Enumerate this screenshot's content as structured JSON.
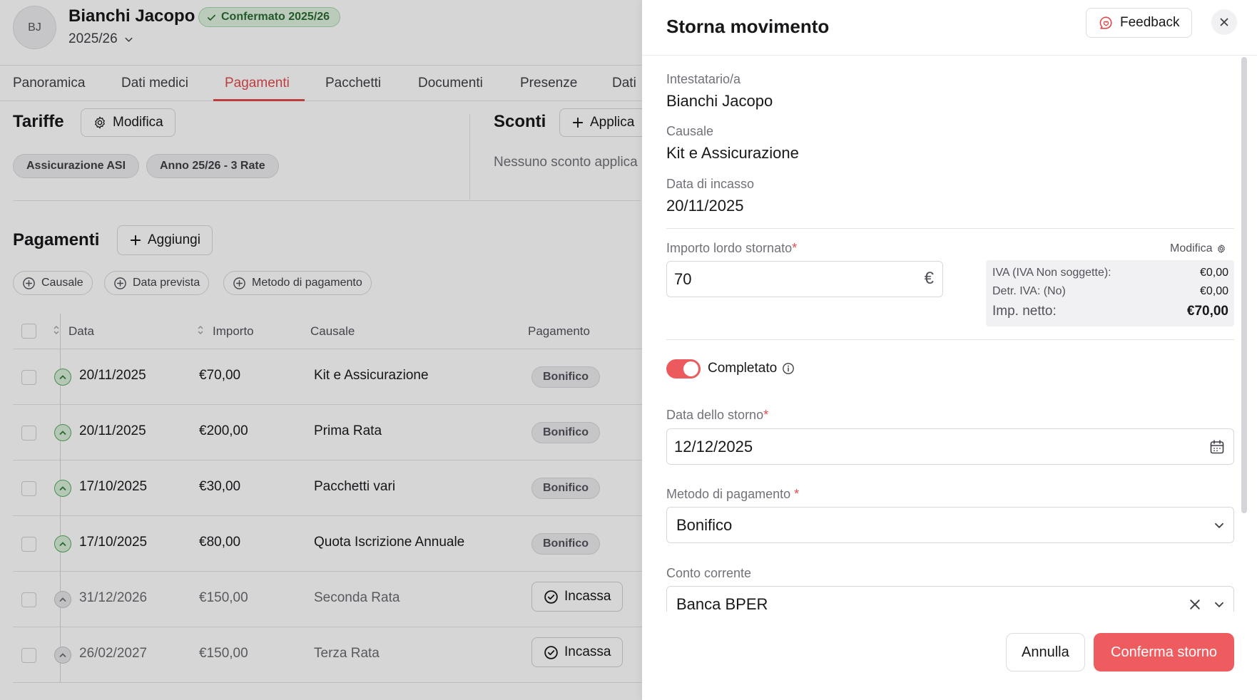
{
  "header": {
    "avatar_initials": "BJ",
    "name": "Bianchi Jacopo",
    "status_badge": "Confermato 2025/26",
    "season": "2025/26"
  },
  "tabs": [
    {
      "label": "Panoramica",
      "active": false
    },
    {
      "label": "Dati medici",
      "active": false
    },
    {
      "label": "Pagamenti",
      "active": true
    },
    {
      "label": "Pacchetti",
      "active": false
    },
    {
      "label": "Documenti",
      "active": false
    },
    {
      "label": "Presenze",
      "active": false
    },
    {
      "label": "Dati",
      "active": false
    }
  ],
  "tariffe": {
    "title": "Tariffe",
    "edit_label": "Modifica",
    "chips": [
      "Assicurazione ASI",
      "Anno 25/26 - 3 Rate"
    ]
  },
  "sconti": {
    "title": "Sconti",
    "apply_label": "Applica",
    "empty_text": "Nessuno sconto applica"
  },
  "pagamenti": {
    "title": "Pagamenti",
    "add_label": "Aggiungi",
    "filters": [
      "Causale",
      "Data prevista",
      "Metodo di pagamento"
    ],
    "columns": {
      "date": "Data",
      "amount": "Importo",
      "causale": "Causale",
      "payment": "Pagamento"
    },
    "rows": [
      {
        "date": "20/11/2025",
        "amount": "€70,00",
        "causale": "Kit e Assicurazione",
        "payment": "Bonifico",
        "status": "paid"
      },
      {
        "date": "20/11/2025",
        "amount": "€200,00",
        "causale": "Prima Rata",
        "payment": "Bonifico",
        "status": "paid"
      },
      {
        "date": "17/10/2025",
        "amount": "€30,00",
        "causale": "Pacchetti vari",
        "payment": "Bonifico",
        "status": "paid"
      },
      {
        "date": "17/10/2025",
        "amount": "€80,00",
        "causale": "Quota Iscrizione Annuale",
        "payment": "Bonifico",
        "status": "paid"
      },
      {
        "date": "31/12/2026",
        "amount": "€150,00",
        "causale": "Seconda Rata",
        "payment": "Incassa",
        "status": "pending"
      },
      {
        "date": "26/02/2027",
        "amount": "€150,00",
        "causale": "Terza Rata",
        "payment": "Incassa",
        "status": "pending"
      }
    ]
  },
  "panel": {
    "title": "Storna movimento",
    "feedback_label": "Feedback",
    "intestatario_label": "Intestatario/a",
    "intestatario_value": "Bianchi Jacopo",
    "causale_label": "Causale",
    "causale_value": "Kit e Assicurazione",
    "data_incasso_label": "Data di incasso",
    "data_incasso_value": "20/11/2025",
    "importo_label": "Importo lordo stornato",
    "importo_value": "70",
    "currency_symbol": "€",
    "modifica_label": "Modifica",
    "iva_label": "IVA (IVA Non soggette):",
    "iva_value": "€0,00",
    "detr_label": "Detr. IVA: (No)",
    "detr_value": "€0,00",
    "netto_label": "Imp. netto:",
    "netto_value": "€70,00",
    "completato_label": "Completato",
    "completato_on": true,
    "data_storno_label": "Data dello storno",
    "data_storno_value": "12/12/2025",
    "metodo_label": "Metodo di pagamento",
    "metodo_value": "Bonifico",
    "conto_label": "Conto corrente",
    "conto_value": "Banca BPER",
    "cancel_label": "Annulla",
    "confirm_label": "Conferma storno"
  },
  "colors": {
    "accent": "#ee5c5f",
    "active_tab": "#e24b4e",
    "success_badge_bg": "#dff2df"
  }
}
